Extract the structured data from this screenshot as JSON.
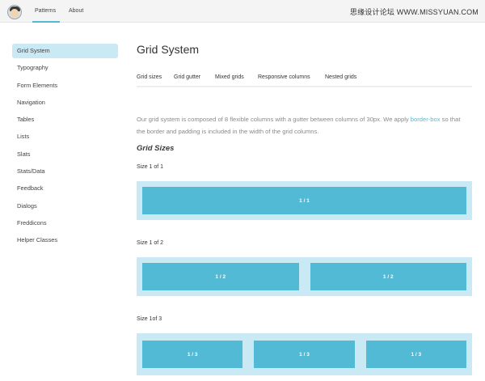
{
  "header": {
    "nav": [
      "Patterns",
      "About"
    ],
    "watermark": "思缘设计论坛 WWW.MISSYUAN.COM"
  },
  "sidebar": {
    "items": [
      {
        "label": "Grid System"
      },
      {
        "label": "Typography"
      },
      {
        "label": "Form Elements"
      },
      {
        "label": "Navigation"
      },
      {
        "label": "Tables"
      },
      {
        "label": "Lists"
      },
      {
        "label": "Slats"
      },
      {
        "label": "Stats/Data"
      },
      {
        "label": "Feedback"
      },
      {
        "label": "Dialogs"
      },
      {
        "label": "Freddicons"
      },
      {
        "label": "Helper Classes"
      }
    ]
  },
  "main": {
    "title": "Grid System",
    "tabs": [
      "Grid sizes",
      "Grid gutter",
      "Mixed grids",
      "Responsive columns",
      "Nested grids"
    ],
    "intro": {
      "before": "Our grid system is composed of 8 flexible columns with a gutter between columns of 30px. We apply ",
      "link": "border-box",
      "after": " so that the border and padding is included in the width of the grid columns."
    },
    "section_title": "Grid Sizes",
    "sizes": [
      {
        "label": "Size 1 of 1",
        "cols": [
          "1 / 1"
        ]
      },
      {
        "label": "Size 1 of 2",
        "cols": [
          "1 / 2",
          "1 / 2"
        ]
      },
      {
        "label": "Size 1of 3",
        "cols": [
          "1 / 3",
          "1 / 3",
          "1 / 3"
        ]
      }
    ]
  }
}
